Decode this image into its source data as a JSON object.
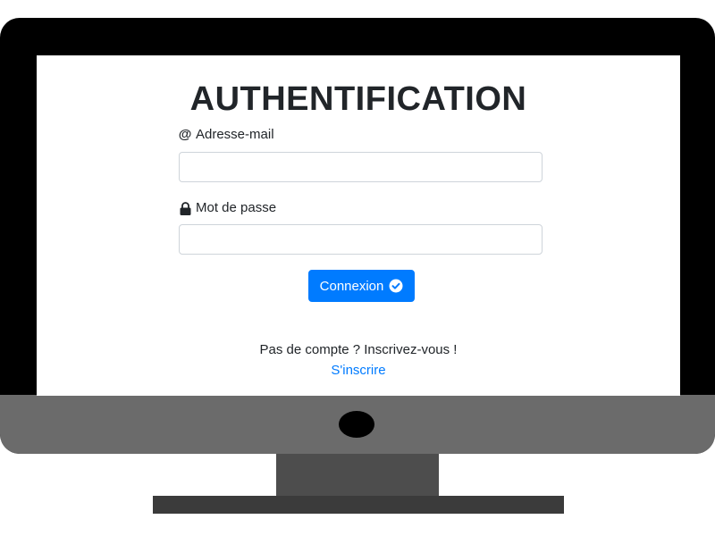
{
  "page": {
    "title": "AUTHENTIFICATION"
  },
  "form": {
    "email": {
      "label": "Adresse-mail",
      "icon": "at-icon",
      "value": "",
      "placeholder": ""
    },
    "password": {
      "label": "Mot de passe",
      "icon": "lock-icon",
      "value": "",
      "placeholder": ""
    },
    "submit": {
      "label": "Connexion",
      "icon": "check-circle-icon"
    }
  },
  "signup": {
    "prompt": "Pas de compte ? Inscrivez-vous !",
    "link_label": "S'inscrire"
  },
  "colors": {
    "primary": "#007bff",
    "text": "#212529",
    "monitor_frame": "#000000",
    "monitor_chin": "#6b6b6b",
    "stand_neck": "#4d4d4d",
    "stand_base": "#3b3b3b",
    "input_border": "#ced4da"
  }
}
